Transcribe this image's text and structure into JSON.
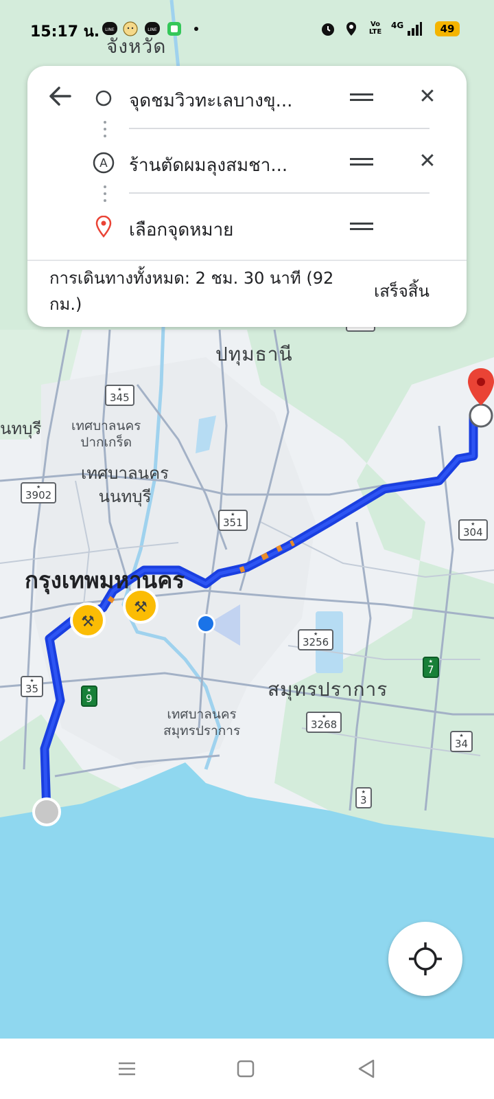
{
  "status_bar": {
    "time": "15:17 น.",
    "battery": "49",
    "icons": [
      "line-icon",
      "emoji-icon",
      "line-icon",
      "message-icon",
      "alarm-icon",
      "location-icon",
      "volte-icon",
      "4g-signal-icon",
      "battery-icon"
    ],
    "volte_label": "Vo LTE",
    "net_label": "4G"
  },
  "directions": {
    "origin": "จุดชมวิวทะเลบางขุ...",
    "stop_label": "A",
    "stop": "ร้านตัดผมลุงสมชา...",
    "destination_placeholder": "เลือกจุดหมาย",
    "summary": "การเดินทางทั้งหมด: 2 ชม. 30 นาที (92 กม.)",
    "done": "เสร็จสิ้น"
  },
  "map": {
    "labels": {
      "top_province": "จังหวัด",
      "pathum": "ปทุมธานี",
      "nonthaburi_edge": "นทบุรี",
      "pakkret": "เทศบาลนคร\nปากเกร็ด",
      "nonthaburi_city": "เทศบาลนคร\nนนทบุรี",
      "bangkok": "กรุงเทพมหานคร",
      "samut_prakan": "สมุทรปราการ",
      "samut_prakan_city": "เทศบาลนคร\nสมุทรปราการ"
    },
    "shields": [
      "305",
      "345",
      "3902",
      "351",
      "304",
      "3256",
      "7",
      "35",
      "9",
      "3268",
      "34",
      "3"
    ],
    "route_color": "#1a3fe0",
    "water_color": "#8fd7ef",
    "green_color": "#d4ecdb",
    "destination_pin_color": "#ea4335"
  },
  "nav": {
    "icons": [
      "menu-icon",
      "home-square-icon",
      "back-triangle-icon"
    ]
  }
}
